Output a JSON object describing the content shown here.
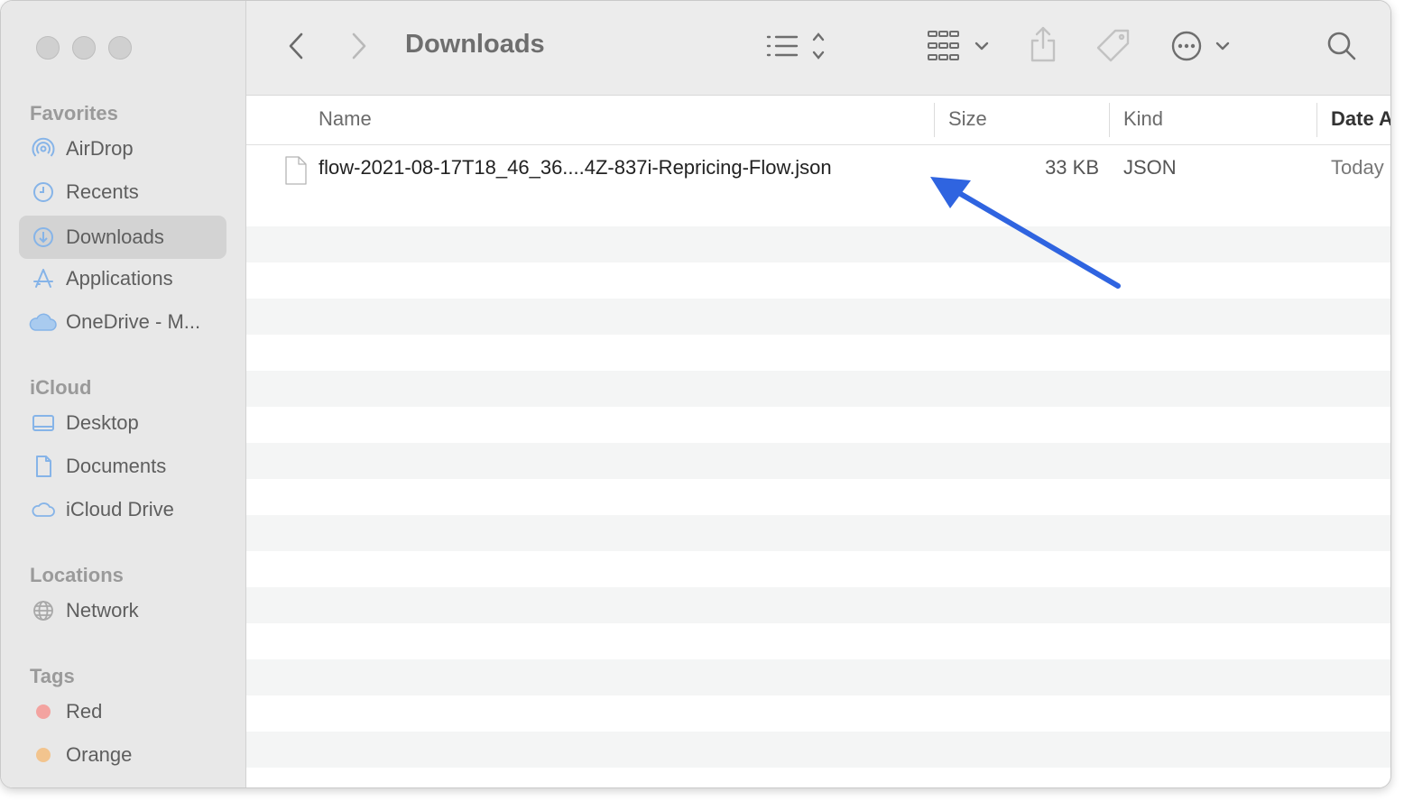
{
  "toolbar": {
    "title": "Downloads",
    "back_icon": "chevron-left-icon",
    "forward_icon": "chevron-right-icon",
    "view_icon": "list-view-icon",
    "group_icon": "grid-group-icon",
    "share_icon": "share-icon",
    "tag_icon": "tag-icon",
    "more_icon": "ellipsis-circle-icon",
    "search_icon": "magnifier-icon"
  },
  "sidebar": {
    "favorites_title": "Favorites",
    "favorites": [
      {
        "label": "AirDrop",
        "icon": "airdrop-icon"
      },
      {
        "label": "Recents",
        "icon": "clock-icon"
      },
      {
        "label": "Downloads",
        "icon": "download-icon",
        "selected": true
      },
      {
        "label": "Applications",
        "icon": "applications-icon"
      },
      {
        "label": "OneDrive - M...",
        "icon": "cloud-icon"
      }
    ],
    "icloud_title": "iCloud",
    "icloud": [
      {
        "label": "Desktop",
        "icon": "desktop-icon"
      },
      {
        "label": "Documents",
        "icon": "document-icon"
      },
      {
        "label": "iCloud Drive",
        "icon": "cloud-outline-icon"
      }
    ],
    "locations_title": "Locations",
    "locations": [
      {
        "label": "Network",
        "icon": "globe-icon"
      }
    ],
    "tags_title": "Tags",
    "tags": [
      {
        "label": "Red",
        "color": "#f3a3a0"
      },
      {
        "label": "Orange",
        "color": "#f2c48e"
      }
    ]
  },
  "columns": {
    "name": "Name",
    "size": "Size",
    "kind": "Kind",
    "date": "Date A"
  },
  "files": [
    {
      "name": "flow-2021-08-17T18_46_36....4Z-837i-Repricing-Flow.json",
      "size": "33 KB",
      "kind": "JSON",
      "date": "Today"
    }
  ],
  "annotation": {
    "arrow_color": "#2f64e0"
  }
}
